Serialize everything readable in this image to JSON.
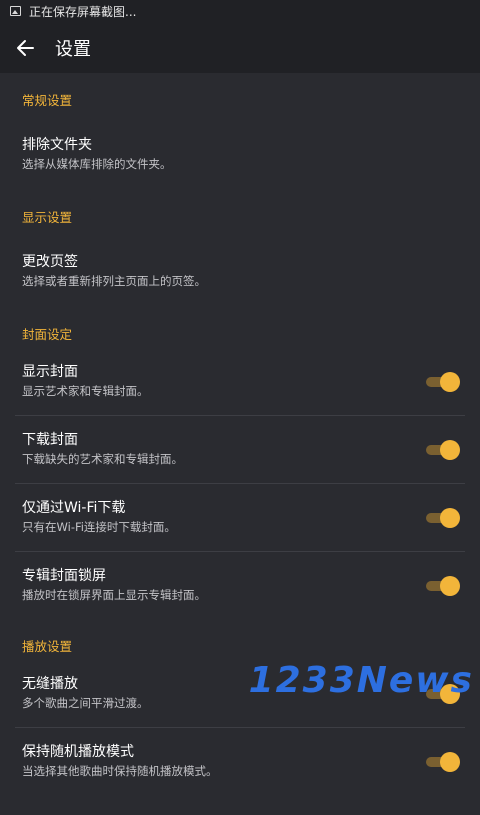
{
  "status_bar": {
    "text": "正在保存屏幕截图..."
  },
  "app_bar": {
    "title": "设置"
  },
  "sections": [
    {
      "header": "常规设置"
    },
    {
      "header": "显示设置"
    },
    {
      "header": "封面设定"
    },
    {
      "header": "播放设置"
    }
  ],
  "items": {
    "exclude_folders": {
      "title": "排除文件夹",
      "subtitle": "选择从媒体库排除的文件夹。"
    },
    "change_tabs": {
      "title": "更改页签",
      "subtitle": "选择或者重新排列主页面上的页签。"
    },
    "show_cover": {
      "title": "显示封面",
      "subtitle": "显示艺术家和专辑封面。",
      "enabled": true
    },
    "download_cover": {
      "title": "下载封面",
      "subtitle": "下载缺失的艺术家和专辑封面。",
      "enabled": true
    },
    "wifi_only": {
      "title": "仅通过Wi-Fi下载",
      "subtitle": "只有在Wi-Fi连接时下载封面。",
      "enabled": true
    },
    "lockscreen_cover": {
      "title": "专辑封面锁屏",
      "subtitle": "播放时在锁屏界面上显示专辑封面。",
      "enabled": true
    },
    "gapless": {
      "title": "无缝播放",
      "subtitle": "多个歌曲之间平滑过渡。",
      "enabled": true
    },
    "keep_shuffle": {
      "title": "保持随机播放模式",
      "subtitle": "当选择其他歌曲时保持随机播放模式。",
      "enabled": true
    }
  },
  "watermark": "1233News",
  "colors": {
    "accent": "#f2b53a",
    "background": "#2a2b30",
    "app_bar": "#202125"
  }
}
